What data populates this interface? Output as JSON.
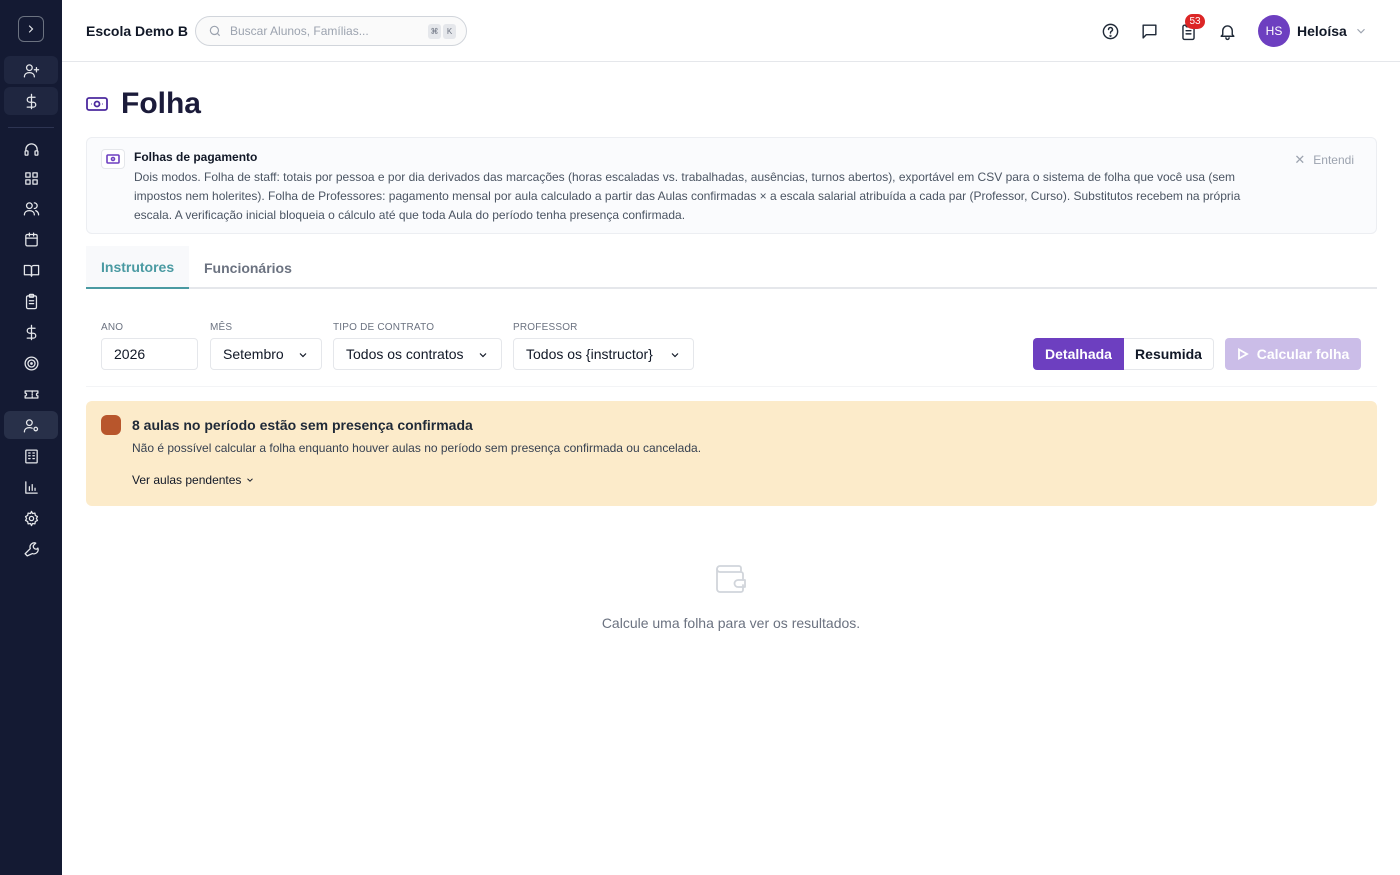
{
  "header": {
    "school_name": "Escola Demo B",
    "search_placeholder": "Buscar Alunos, Famílias...",
    "shortcut_keys": [
      "⌘",
      "K"
    ],
    "notification_count": "53",
    "user_initials": "HS",
    "user_name": "Heloísa"
  },
  "page": {
    "title": "Folha",
    "icon": "banknote-icon"
  },
  "info": {
    "title": "Folhas de pagamento",
    "text": "Dois modos. Folha de staff: totais por pessoa e por dia derivados das marcações (horas escaladas vs. trabalhadas, ausências, turnos abertos), exportável em CSV para o sistema de folha que você usa (sem impostos nem holerites). Folha de Professores: pagamento mensal por aula calculado a partir das Aulas confirmadas × a escala salarial atribuída a cada par (Professor, Curso). Substitutos recebem na própria escala. A verificação inicial bloqueia o cálculo até que toda Aula do período tenha presença confirmada.",
    "dismiss_label": "Entendi"
  },
  "tabs": [
    {
      "label": "Instrutores",
      "active": true
    },
    {
      "label": "Funcionários",
      "active": false
    }
  ],
  "filters": {
    "year": {
      "label": "ANO",
      "value": "2026"
    },
    "month": {
      "label": "MÊS",
      "value": "Setembro"
    },
    "contract": {
      "label": "TIPO DE CONTRATO",
      "value": "Todos os contratos"
    },
    "professor": {
      "label": "PROFESSOR",
      "value": "Todos os {instructor}"
    }
  },
  "view_toggle": {
    "detailed": "Detalhada",
    "summary": "Resumida",
    "selected": "Detalhada"
  },
  "calculate_label": "Calcular folha",
  "warning": {
    "title": "8 aulas no período estão sem presença confirmada",
    "text": "Não é possível calcular a folha enquanto houver aulas no período sem presença confirmada ou cancelada.",
    "link": "Ver aulas pendentes"
  },
  "empty_state": {
    "text": "Calcule uma folha para ver os resultados."
  },
  "colors": {
    "sidebar_bg": "#141a33",
    "accent_purple": "#6d3fc0",
    "tab_active": "#4a9aa2",
    "warning_bg": "#fcebca",
    "warning_dot": "#b8562c",
    "badge_red": "#dc2626"
  },
  "sidebar": {
    "items": [
      {
        "icon": "user-plus-icon"
      },
      {
        "icon": "dollar-icon"
      },
      {
        "icon": "headset-icon"
      },
      {
        "icon": "dashboard-icon"
      },
      {
        "icon": "users-icon"
      },
      {
        "icon": "calendar-icon"
      },
      {
        "icon": "book-icon"
      },
      {
        "icon": "clipboard-icon"
      },
      {
        "icon": "dollar-icon"
      },
      {
        "icon": "target-icon"
      },
      {
        "icon": "ticket-icon"
      },
      {
        "icon": "user-cog-icon",
        "active": true
      },
      {
        "icon": "building-icon"
      },
      {
        "icon": "bar-chart-icon"
      },
      {
        "icon": "settings-icon"
      },
      {
        "icon": "wrench-icon"
      }
    ]
  }
}
